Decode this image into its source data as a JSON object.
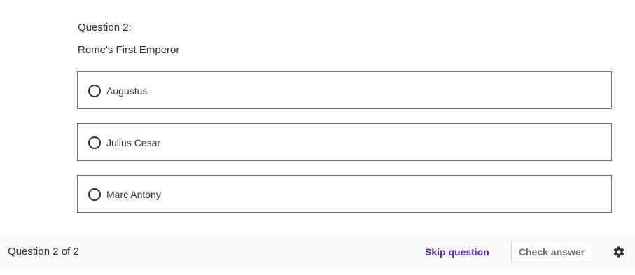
{
  "question": {
    "number_label": "Question 2:",
    "prompt": "Rome's First Emperor",
    "options": [
      {
        "label": "Augustus",
        "selected": false
      },
      {
        "label": "Julius Cesar",
        "selected": false
      },
      {
        "label": "Marc Antony",
        "selected": false
      }
    ]
  },
  "footer": {
    "progress_label": "Question 2 of 2",
    "skip_label": "Skip question",
    "check_label": "Check answer",
    "settings_icon": "gear-icon"
  },
  "colors": {
    "accent": "#5624d0",
    "border": "#6a6f73",
    "footer_bg": "#f7f9fa",
    "text": "#2d2f31"
  }
}
